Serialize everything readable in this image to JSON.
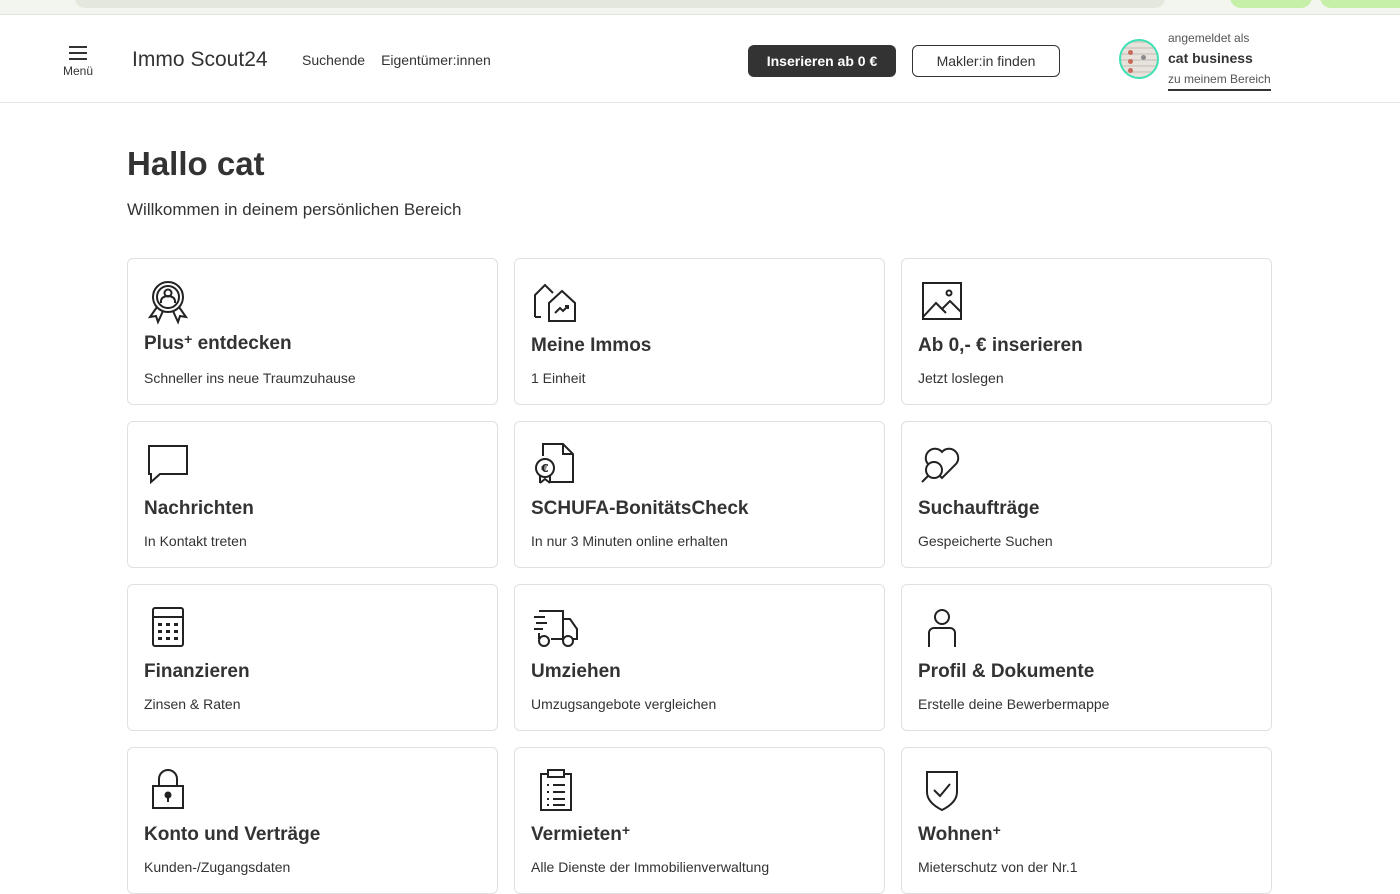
{
  "header": {
    "menu_label": "Menü",
    "logo": {
      "part1": "Immo",
      "part2": "Scout24"
    },
    "nav": [
      "Suchende",
      "Eigentümer:innen"
    ],
    "cta_primary": "Inserieren ab 0 €",
    "cta_secondary": "Makler:in finden",
    "user": {
      "prefix": "angemeldet als",
      "name": "cat business",
      "link": "zu meinem Bereich"
    }
  },
  "page": {
    "greeting": "Hallo cat",
    "subtitle": "Willkommen in deinem persönlichen Bereich"
  },
  "cards": [
    {
      "icon": "award-badge-icon",
      "title": "Plus",
      "sup": "+",
      "title_suffix": " entdecken",
      "desc": "Schneller ins neue Traumzuhause"
    },
    {
      "icon": "houses-chart-icon",
      "title": "Meine Immos",
      "sup": "",
      "title_suffix": "",
      "desc": "1 Einheit"
    },
    {
      "icon": "image-icon",
      "title": "Ab 0,- € inserieren",
      "sup": "",
      "title_suffix": "",
      "desc": "Jetzt loslegen"
    },
    {
      "icon": "chat-bubble-icon",
      "title": "Nachrichten",
      "sup": "",
      "title_suffix": "",
      "desc": "In Kontakt treten"
    },
    {
      "icon": "document-euro-icon",
      "title": "SCHUFA-BonitätsCheck",
      "sup": "",
      "title_suffix": "",
      "desc": "In nur 3 Minuten online erhalten"
    },
    {
      "icon": "search-heart-icon",
      "title": "Suchaufträge",
      "sup": "",
      "title_suffix": "",
      "desc": "Gespeicherte Suchen"
    },
    {
      "icon": "calculator-icon",
      "title": "Finanzieren",
      "sup": "",
      "title_suffix": "",
      "desc": "Zinsen & Raten"
    },
    {
      "icon": "moving-truck-icon",
      "title": "Umziehen",
      "sup": "",
      "title_suffix": "",
      "desc": "Umzugsangebote vergleichen"
    },
    {
      "icon": "person-icon",
      "title": "Profil & Dokumente",
      "sup": "",
      "title_suffix": "",
      "desc": "Erstelle deine Bewerbermappe"
    },
    {
      "icon": "lock-icon",
      "title": "Konto und Verträge",
      "sup": "",
      "title_suffix": "",
      "desc": "Kunden-/Zugangsdaten"
    },
    {
      "icon": "clipboard-list-icon",
      "title": "Vermieten",
      "sup": "+",
      "title_suffix": "",
      "desc": "Alle Dienste der Immobilienverwaltung"
    },
    {
      "icon": "shield-check-icon",
      "title": "Wohnen",
      "sup": "+",
      "title_suffix": "",
      "desc": "Mieterschutz von der Nr.1"
    }
  ],
  "colors": {
    "accent": "#3ee0b4",
    "dark": "#333333",
    "border": "#e0e0e0"
  }
}
